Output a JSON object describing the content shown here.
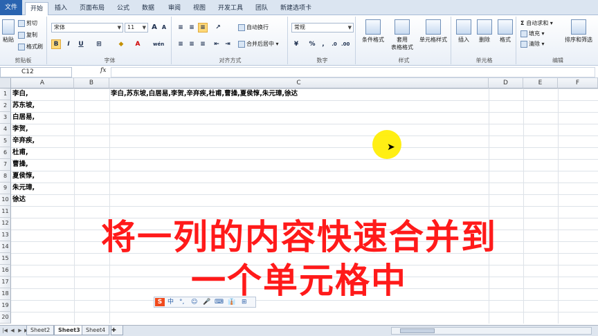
{
  "tabs": [
    "文件",
    "开始",
    "插入",
    "页面布局",
    "公式",
    "数据",
    "审阅",
    "视图",
    "开发工具",
    "团队",
    "新建选项卡"
  ],
  "active_tab": "开始",
  "ribbon": {
    "clipboard": {
      "label": "剪贴板",
      "paste": "粘贴",
      "cut": "剪切",
      "copy": "复制",
      "format_painter": "格式刷"
    },
    "font": {
      "label": "字体",
      "font_name": "宋体",
      "font_size": "11",
      "grow": "A",
      "shrink": "A",
      "bold": "B",
      "italic": "I",
      "underline": "U",
      "wen": "wén"
    },
    "alignment": {
      "label": "对齐方式",
      "wrap_text": "自动换行",
      "merge_center": "合并后居中"
    },
    "number": {
      "label": "数字",
      "format": "常规",
      "percent": "%",
      "comma": ","
    },
    "styles": {
      "label": "样式",
      "conditional": "条件格式",
      "table_format": "套用\n表格格式",
      "cell_styles": "单元格样式"
    },
    "cells": {
      "label": "单元格",
      "insert": "插入",
      "delete": "删除",
      "format": "格式"
    },
    "editing": {
      "label": "编辑",
      "autosum": "自动求和",
      "fill": "填充",
      "clear": "清除",
      "sort_filter": "排序和筛选"
    }
  },
  "formula_bar": {
    "name_box": "C12",
    "fx": "fx",
    "content": ""
  },
  "columns": [
    "A",
    "B",
    "C",
    "D",
    "E",
    "F"
  ],
  "rows": [
    "1",
    "2",
    "3",
    "4",
    "5",
    "6",
    "7",
    "8",
    "9",
    "10",
    "11",
    "12",
    "13",
    "14",
    "15",
    "16",
    "17",
    "18",
    "19",
    "20"
  ],
  "column_a": [
    "李白,",
    "苏东坡,",
    "白居易,",
    "李贺,",
    "辛弃疾,",
    "杜甫,",
    "曹操,",
    "夏侯惇,",
    "朱元璋,",
    "徐达"
  ],
  "c1": "李白,苏东坡,白居易,李贺,辛弃疾,杜甫,曹操,夏侯惇,朱元璋,徐达",
  "caption": {
    "line1": "将一列的内容快速合并到",
    "line2": "一个单元格中"
  },
  "ime": {
    "logo": "S",
    "items": [
      "中",
      "°,",
      "☺",
      "🎤",
      "⌨",
      "👔",
      "⊞"
    ]
  },
  "sheets": [
    "Sheet2",
    "Sheet3",
    "Sheet4"
  ],
  "active_sheet": "Sheet3",
  "colors": {
    "caption": "#ff1a1a",
    "file_tab": "#2a64b0",
    "highlight": "#ffee00"
  }
}
